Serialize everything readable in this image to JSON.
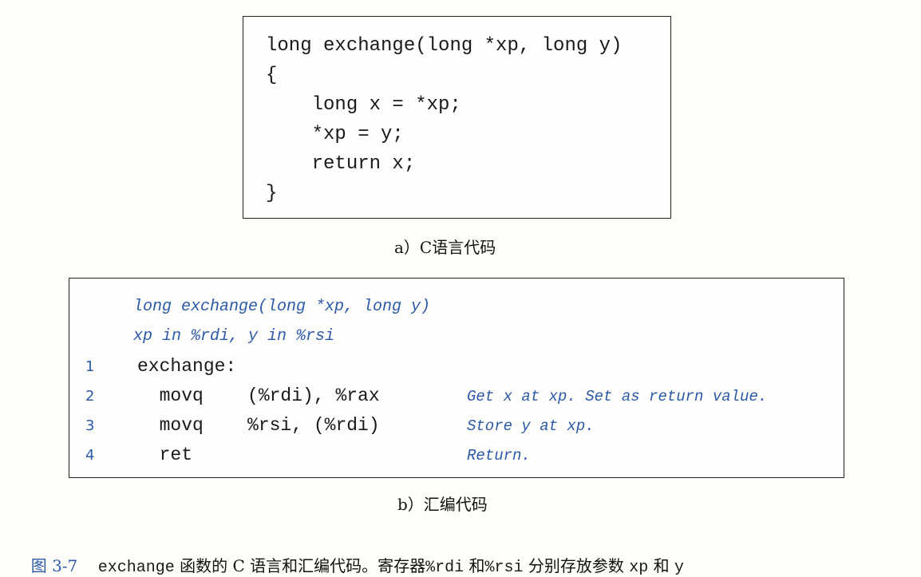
{
  "c_code": {
    "lines": [
      "long exchange(long *xp, long y)",
      "{",
      "    long x = *xp;",
      "    *xp = y;",
      "    return x;",
      "}"
    ],
    "caption": "a）C语言代码"
  },
  "asm_code": {
    "header_lines": [
      "long exchange(long *xp, long y)",
      "xp in %rdi, y in %rsi"
    ],
    "rows": [
      {
        "num": "1",
        "instr": "exchange:",
        "comment": ""
      },
      {
        "num": "2",
        "instr": "  movq    (%rdi), %rax",
        "comment": "Get x at xp. Set as return value."
      },
      {
        "num": "3",
        "instr": "  movq    %rsi, (%rdi)",
        "comment": "Store y at xp."
      },
      {
        "num": "4",
        "instr": "  ret",
        "comment": "Return."
      }
    ],
    "caption": "b）汇编代码"
  },
  "figure_caption": {
    "label": "图 3-7",
    "parts": [
      {
        "text": "exchange",
        "style": "mono"
      },
      {
        "text": " 函数的 C 语言和汇编代码。寄存器",
        "style": "cjk"
      },
      {
        "text": "%rdi",
        "style": "mono"
      },
      {
        "text": " 和",
        "style": "cjk"
      },
      {
        "text": "%rsi",
        "style": "mono"
      },
      {
        "text": " 分别存放参数 ",
        "style": "cjk"
      },
      {
        "text": "xp",
        "style": "mono"
      },
      {
        "text": " 和 ",
        "style": "cjk"
      },
      {
        "text": "y",
        "style": "mono"
      }
    ]
  },
  "colors": {
    "accent_blue": "#2d5aa8",
    "text": "#111111",
    "background": "#fefefa",
    "border": "#222222"
  }
}
